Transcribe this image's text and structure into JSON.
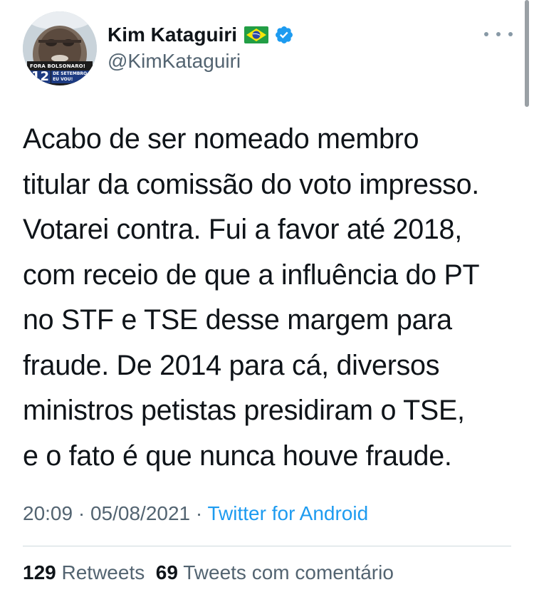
{
  "author": {
    "display_name": "Kim Kataguiri",
    "handle": "@KimKataguiri",
    "flag_icon": "brazil-flag-icon",
    "verified_icon": "verified-badge-icon",
    "verified_color": "#1d9bf0",
    "avatar_caption_line1": "FORA BOLSONARO!",
    "avatar_caption_big": "12",
    "avatar_caption_small": "DE SETEMBRO EU VOU!"
  },
  "more_icon": "more-horizontal-icon",
  "tweet": {
    "lines": [
      "Acabo de ser nomeado membro",
      "titular da comissão do voto impresso.",
      "Votarei contra. Fui a favor até 2018,",
      "com receio de que a influência do PT",
      "no STF e TSE desse margem para",
      "fraude. De 2014 para cá, diversos",
      "ministros petistas presidiram o TSE,",
      "e o fato é que nunca houve fraude."
    ]
  },
  "meta": {
    "time": "20:09",
    "separator1": " · ",
    "date": "05/08/2021",
    "separator2": " · ",
    "source": "Twitter for Android"
  },
  "stats": {
    "retweets_count": "129",
    "retweets_label": "Retweets",
    "quotes_count": "69",
    "quotes_label": "Tweets com comentário"
  },
  "colors": {
    "text": "#0f1419",
    "secondary": "#536471",
    "link": "#1d9bf0",
    "divider": "#cfd9de"
  }
}
